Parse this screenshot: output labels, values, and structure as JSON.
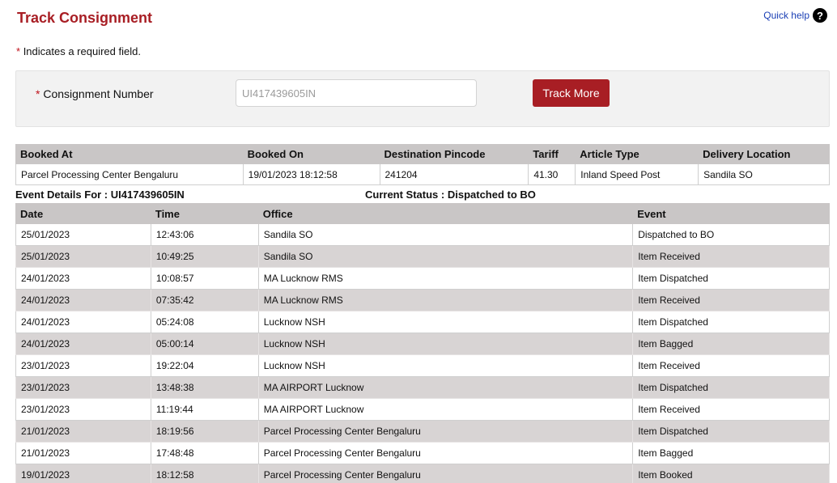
{
  "header": {
    "title": "Track Consignment",
    "quick_help": "Quick help",
    "help_glyph": "?"
  },
  "required_note": {
    "star": "*",
    "text": "Indicates a required field."
  },
  "form": {
    "star": "*",
    "label": "Consignment Number",
    "value": "UI417439605IN",
    "button": "Track More"
  },
  "booking": {
    "headers": [
      "Booked At",
      "Booked On",
      "Destination Pincode",
      "Tariff",
      "Article Type",
      "Delivery Location"
    ],
    "row": [
      "Parcel Processing Center Bengaluru",
      "19/01/2023 18:12:58",
      "241204",
      "41.30",
      "Inland Speed Post",
      "Sandila SO"
    ]
  },
  "event_title": "Event Details For : UI417439605IN",
  "status_title": "Current Status : Dispatched to BO",
  "events": {
    "headers": [
      "Date",
      "Time",
      "Office",
      "Event"
    ],
    "rows": [
      [
        "25/01/2023",
        "12:43:06",
        "Sandila SO",
        "Dispatched to BO"
      ],
      [
        "25/01/2023",
        "10:49:25",
        "Sandila SO",
        "Item Received"
      ],
      [
        "24/01/2023",
        "10:08:57",
        "MA Lucknow RMS",
        "Item Dispatched"
      ],
      [
        "24/01/2023",
        "07:35:42",
        "MA Lucknow RMS",
        "Item Received"
      ],
      [
        "24/01/2023",
        "05:24:08",
        "Lucknow NSH",
        "Item Dispatched"
      ],
      [
        "24/01/2023",
        "05:00:14",
        "Lucknow NSH",
        "Item Bagged"
      ],
      [
        "23/01/2023",
        "19:22:04",
        "Lucknow NSH",
        "Item Received"
      ],
      [
        "23/01/2023",
        "13:48:38",
        "MA AIRPORT Lucknow",
        "Item Dispatched"
      ],
      [
        "23/01/2023",
        "11:19:44",
        "MA AIRPORT Lucknow",
        "Item Received"
      ],
      [
        "21/01/2023",
        "18:19:56",
        "Parcel Processing Center Bengaluru",
        "Item Dispatched"
      ],
      [
        "21/01/2023",
        "17:48:48",
        "Parcel Processing Center Bengaluru",
        "Item Bagged"
      ],
      [
        "19/01/2023",
        "18:12:58",
        "Parcel Processing Center Bengaluru",
        "Item Booked"
      ]
    ]
  },
  "colors": {
    "brand": "#a81e24",
    "link": "#1a3fb5",
    "header_bg": "#c9c6c6",
    "stripe_bg": "#d8d4d4"
  }
}
